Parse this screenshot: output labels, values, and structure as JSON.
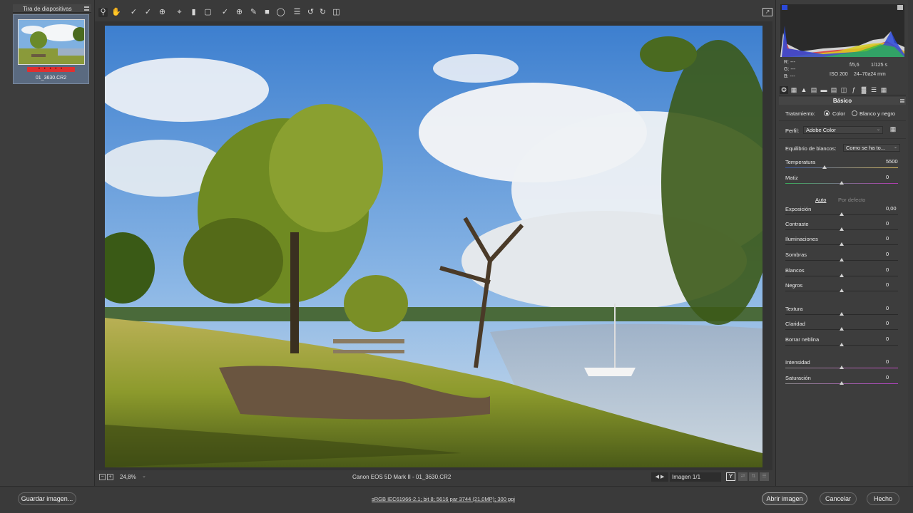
{
  "filmstrip": {
    "title": "Tira de diapositivas",
    "items": [
      {
        "filename": "01_3630.CR2",
        "rating_label": "• • • • •"
      }
    ]
  },
  "toolbar": {
    "tools": [
      "zoom-icon",
      "hand-icon",
      "white-balance-icon",
      "color-sampler-icon",
      "target-adjust-icon",
      "crop-icon",
      "straighten-icon",
      "transform-icon",
      "spot-removal-icon",
      "red-eye-icon",
      "adjustment-brush-icon",
      "graduated-filter-icon",
      "radial-filter-icon",
      "preferences-icon",
      "rotate-ccw-icon",
      "rotate-cw-icon",
      "trash-icon"
    ],
    "fullscreen_icon": "fullscreen-icon"
  },
  "status": {
    "zoom": "24,8%",
    "camera": "Canon EOS 5D Mark II -  01_3630.CR2",
    "image_count": "Imagen 1/1",
    "view_mode": "Y"
  },
  "histogram": {
    "r": "R:    ---",
    "g": "G:    ---",
    "b": "B:    ---",
    "aperture": "f/5,6",
    "shutter": "1/125 s",
    "iso": "ISO 200",
    "lens": "24–70a24 mm"
  },
  "panel": {
    "title": "Básico",
    "treatment_label": "Tratamiento:",
    "treatment_color": "Color",
    "treatment_bw": "Blanco y negro",
    "profile_label": "Perfil:",
    "profile_value": "Adobe Color",
    "wb_label": "Equilibrio de blancos:",
    "wb_value": "Como se ha to...",
    "auto_link": "Auto",
    "default_link": "Por defecto",
    "sliders": [
      {
        "label": "Temperatura",
        "value": "5500"
      },
      {
        "label": "Matiz",
        "value": "0"
      },
      {
        "label": "Exposición",
        "value": "0,00"
      },
      {
        "label": "Contraste",
        "value": "0"
      },
      {
        "label": "Iluminaciones",
        "value": "0"
      },
      {
        "label": "Sombras",
        "value": "0"
      },
      {
        "label": "Blancos",
        "value": "0"
      },
      {
        "label": "Negros",
        "value": "0"
      },
      {
        "label": "Textura",
        "value": "0"
      },
      {
        "label": "Claridad",
        "value": "0"
      },
      {
        "label": "Borrar neblina",
        "value": "0"
      },
      {
        "label": "Intensidad",
        "value": "0"
      },
      {
        "label": "Saturación",
        "value": "0"
      }
    ]
  },
  "bottom": {
    "save_label": "Guardar imagen...",
    "workflow": "sRGB IEC61966-2.1; bit 8; 5616 par 3744 (21,0MP); 300 ppi",
    "open_label": "Abrir imagen",
    "cancel_label": "Cancelar",
    "done_label": "Hecho"
  },
  "colors": {
    "accent": "#e03030",
    "panel": "#3d3d3d",
    "background": "#3a3a3a"
  }
}
